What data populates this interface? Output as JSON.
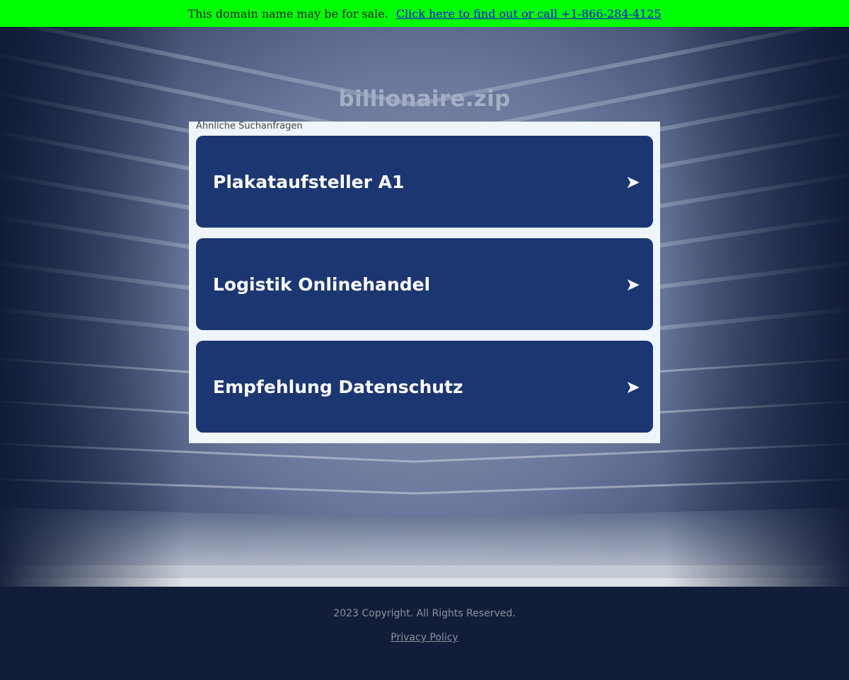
{
  "banner": {
    "text": "This domain name may be for sale.",
    "link_text": "Click here to find out or call +1-866-284-4125",
    "background_color": "#00ff00"
  },
  "site": {
    "title": "billionaire.zip"
  },
  "related": {
    "heading": "Ähnliche Suchanfragen",
    "items": [
      {
        "label": "Plakataufsteller A1",
        "icon": "arrow-right-icon"
      },
      {
        "label": "Logistik Onlinehandel",
        "icon": "arrow-right-icon"
      },
      {
        "label": "Empfehlung Datenschutz",
        "icon": "arrow-right-icon"
      }
    ],
    "item_color": "#1c3672",
    "arrow_glyph": "➤"
  },
  "footer": {
    "copyright": "2023 Copyright. All Rights Reserved.",
    "privacy_label": "Privacy Policy"
  }
}
